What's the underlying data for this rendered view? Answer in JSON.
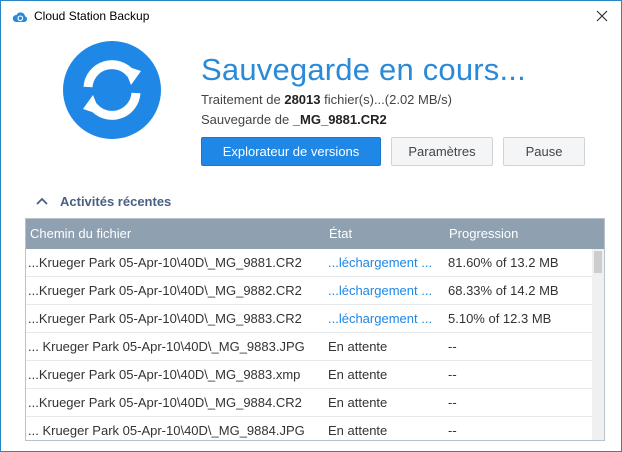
{
  "window": {
    "title": "Cloud Station Backup",
    "accent": "#1f87e5",
    "title_color": "#2b8ad8"
  },
  "status": {
    "title": "Sauvegarde en cours...",
    "processing_prefix": "Traitement de ",
    "file_count": "28013",
    "processing_suffix": " fichier(s)...(2.02 MB/s)",
    "backup_prefix": "Sauvegarde de ",
    "current_file": "_MG_9881.CR2"
  },
  "buttons": {
    "explorer": "Explorateur de versions",
    "settings": "Paramètres",
    "pause": "Pause"
  },
  "recent": {
    "label": "Activités récentes"
  },
  "table": {
    "headers": {
      "path": "Chemin du fichier",
      "state": "État",
      "progress": "Progression"
    },
    "rows": [
      {
        "path": "...Krueger Park 05-Apr-10\\40D\\_MG_9881.CR2",
        "state": "...léchargement ...",
        "progress": "81.60% of 13.2 MB",
        "active": true
      },
      {
        "path": "...Krueger Park 05-Apr-10\\40D\\_MG_9882.CR2",
        "state": "...léchargement ...",
        "progress": "68.33% of 14.2 MB",
        "active": true
      },
      {
        "path": "...Krueger Park 05-Apr-10\\40D\\_MG_9883.CR2",
        "state": "...léchargement ...",
        "progress": "5.10% of 12.3 MB",
        "active": true
      },
      {
        "path": "... Krueger Park 05-Apr-10\\40D\\_MG_9883.JPG",
        "state": "En attente",
        "progress": "--",
        "active": false
      },
      {
        "path": "...Krueger Park 05-Apr-10\\40D\\_MG_9883.xmp",
        "state": "En attente",
        "progress": "--",
        "active": false
      },
      {
        "path": "...Krueger Park 05-Apr-10\\40D\\_MG_9884.CR2",
        "state": "En attente",
        "progress": "--",
        "active": false
      },
      {
        "path": "... Krueger Park 05-Apr-10\\40D\\_MG_9884.JPG",
        "state": "En attente",
        "progress": "--",
        "active": false
      }
    ]
  }
}
